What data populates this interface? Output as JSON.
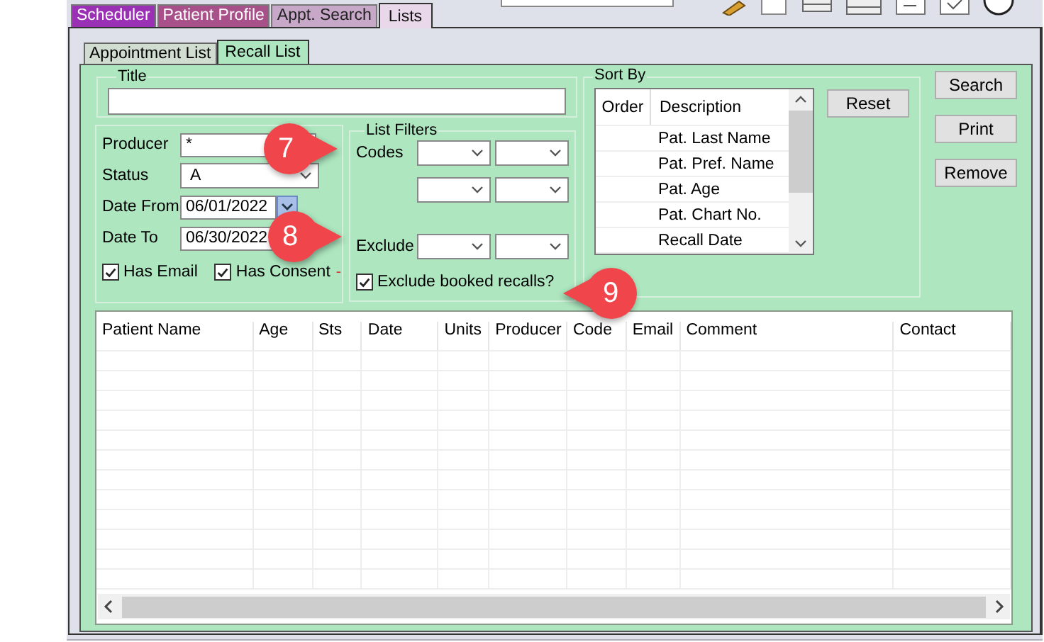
{
  "main_tabs": [
    {
      "label": "Scheduler",
      "selected": false,
      "color": "#9a30b4"
    },
    {
      "label": "Patient Profile",
      "selected": false,
      "color": "#a8508a"
    },
    {
      "label": "Appt. Search",
      "selected": false,
      "color": "#c8a8c8"
    },
    {
      "label": "Lists",
      "selected": true,
      "color": "#e8d8ea"
    }
  ],
  "sub_tabs": [
    {
      "label": "Appointment List",
      "selected": false
    },
    {
      "label": "Recall List",
      "selected": true
    }
  ],
  "title_group": {
    "label": "Title"
  },
  "filters": [
    {
      "kind": "text",
      "label": "Producer",
      "value": "*"
    },
    {
      "kind": "combo",
      "label": "Status",
      "value": "A"
    },
    {
      "kind": "date",
      "label": "Date From",
      "value": "06/01/2022"
    },
    {
      "kind": "date",
      "label": "Date To",
      "value": "06/30/2022"
    }
  ],
  "checks": [
    {
      "label": "Has Email",
      "checked": true
    },
    {
      "label": "Has Consent",
      "checked": true
    }
  ],
  "consent_marker": "-",
  "list_filters": {
    "label": "List Filters",
    "codes_label": "Codes",
    "exclude_label": "Exclude"
  },
  "exclude_booked": {
    "label": "Exclude booked recalls?",
    "checked": true
  },
  "sort_by": {
    "label": "Sort By",
    "columns": [
      "Order",
      "Description"
    ],
    "rows": [
      "Pat. Last Name",
      "Pat. Pref. Name",
      "Pat. Age",
      "Pat. Chart No.",
      "Recall Date"
    ],
    "reset": "Reset"
  },
  "buttons": [
    "Search",
    "Print",
    "Remove"
  ],
  "table": {
    "columns": [
      "Patient Name",
      "Age",
      "Sts",
      "Date",
      "Units",
      "Producer",
      "Code",
      "Email",
      "Comment",
      "Contact"
    ]
  },
  "callouts": [
    {
      "label": "7"
    },
    {
      "label": "8"
    },
    {
      "label": "9"
    }
  ]
}
